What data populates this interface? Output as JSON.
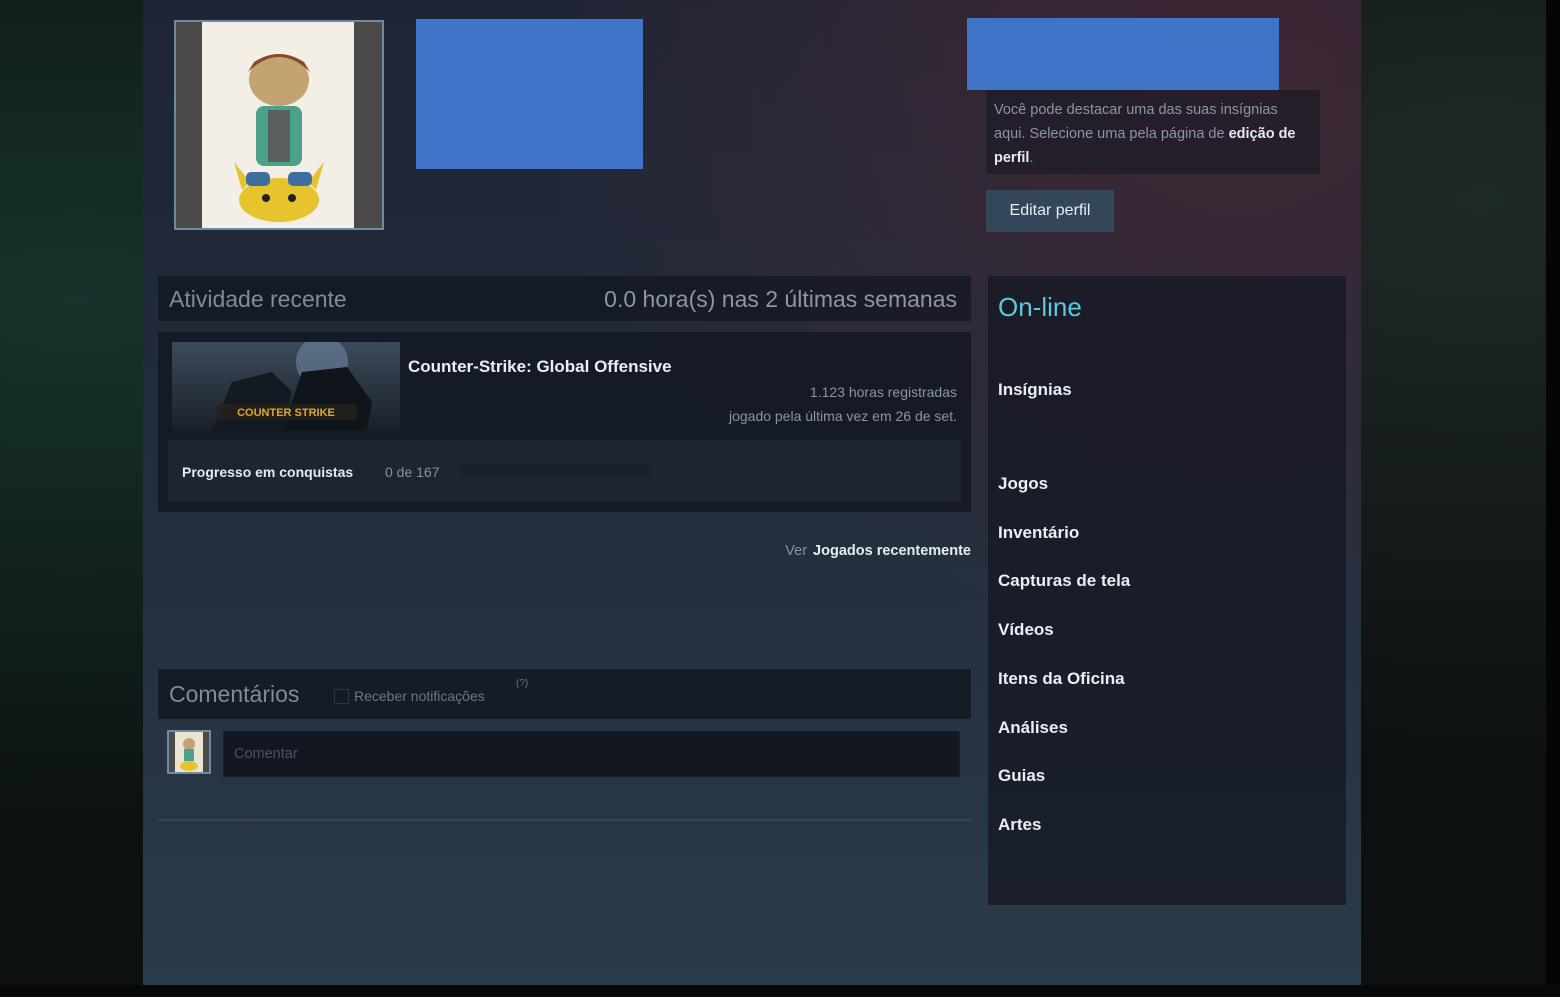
{
  "header": {
    "badge_hint_text": "Você pode destacar uma das suas insígnias aqui. Selecione uma pela página de",
    "badge_hint_link": "edição de perfil",
    "badge_hint_end": ".",
    "edit_profile_label": "Editar perfil"
  },
  "activity": {
    "title": "Atividade recente",
    "hours_summary": "0.0 hora(s) nas 2 últimas semanas",
    "game": {
      "name": "Counter-Strike: Global Offensive",
      "capsule_text": "COUNTER STRIKE",
      "hours_on_record": "1.123 horas registradas",
      "last_played": "jogado pela última vez em 26 de set.",
      "achievement_label": "Progresso em conquistas",
      "achievement_count": "0 de 167",
      "achievement_progress": 0
    },
    "view_prefix": "Ver",
    "view_link": "Jogados recentemente"
  },
  "comments": {
    "title": "Comentários",
    "notify_label": "Receber notificações",
    "notify_help": "(?)",
    "input_placeholder": "Comentar"
  },
  "sidebar": {
    "status": "On-line",
    "links": [
      "Insígnias",
      "Jogos",
      "Inventário",
      "Capturas de tela",
      "Vídeos",
      "Itens da Oficina",
      "Análises",
      "Guias",
      "Artes"
    ]
  },
  "colors": {
    "online": "#57cbde",
    "redaction": "#3f74c9",
    "link_text": "#e9eff4"
  }
}
